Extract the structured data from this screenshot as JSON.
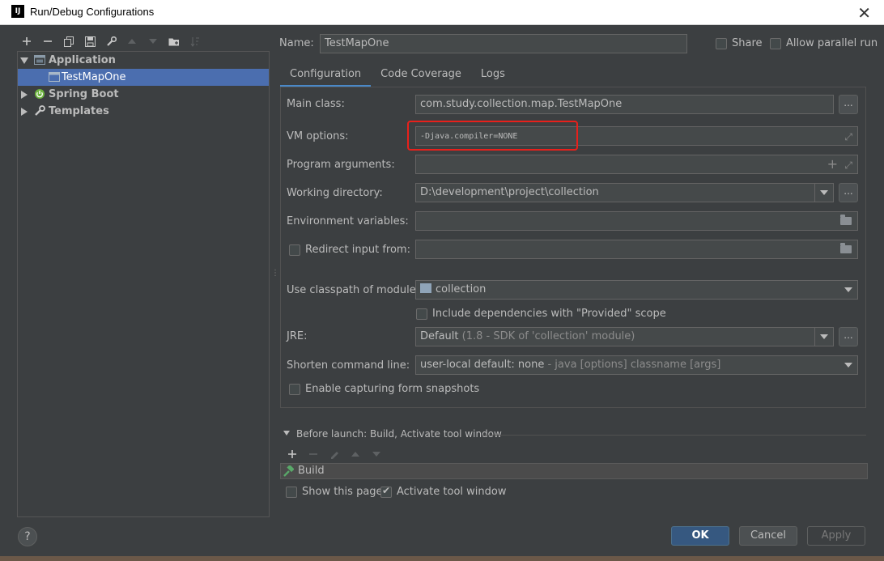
{
  "window": {
    "title": "Run/Debug Configurations",
    "app_icon_text": "IJ"
  },
  "tree": {
    "items": [
      {
        "label": "Application",
        "bold": true,
        "expanded": true
      },
      {
        "label": "TestMapOne",
        "selected": true
      },
      {
        "label": "Spring Boot",
        "bold": true,
        "expanded": false
      },
      {
        "label": "Templates",
        "bold": true,
        "expanded": false
      }
    ]
  },
  "header": {
    "name_label": "Name:",
    "name_value": "TestMapOne",
    "share_label": "Share",
    "parallel_label": "Allow parallel run"
  },
  "tabs": [
    {
      "label": "Configuration",
      "active": true
    },
    {
      "label": "Code Coverage"
    },
    {
      "label": "Logs"
    }
  ],
  "form": {
    "main_class_label": "Main class:",
    "main_class_value": "com.study.collection.map.TestMapOne",
    "vm_options_label": "VM options:",
    "vm_options_value": "-Djava.compiler=NONE",
    "program_args_label": "Program arguments:",
    "working_dir_label": "Working directory:",
    "working_dir_value": "D:\\development\\project\\collection",
    "env_vars_label": "Environment variables:",
    "redirect_label": "Redirect input from:",
    "classpath_label": "Use classpath of module:",
    "classpath_value": "collection",
    "include_deps_label": "Include dependencies with \"Provided\" scope",
    "jre_label": "JRE:",
    "jre_value_main": "Default",
    "jre_value_detail": "(1.8 - SDK of 'collection' module)",
    "shorten_label": "Shorten command line:",
    "shorten_value_main": "user-local default: none",
    "shorten_value_detail": "- java [options] classname [args]",
    "snapshots_label": "Enable capturing form snapshots",
    "dots": "..."
  },
  "before_launch": {
    "title": "Before launch: Build, Activate tool window",
    "item": "Build",
    "show_page_label": "Show this page",
    "activate_label": "Activate tool window"
  },
  "buttons": {
    "ok": "OK",
    "cancel": "Cancel",
    "apply": "Apply",
    "help": "?"
  },
  "colors": {
    "accent": "#4a88c7",
    "selection": "#4b6eaf",
    "highlight_box": "#e8201b"
  }
}
